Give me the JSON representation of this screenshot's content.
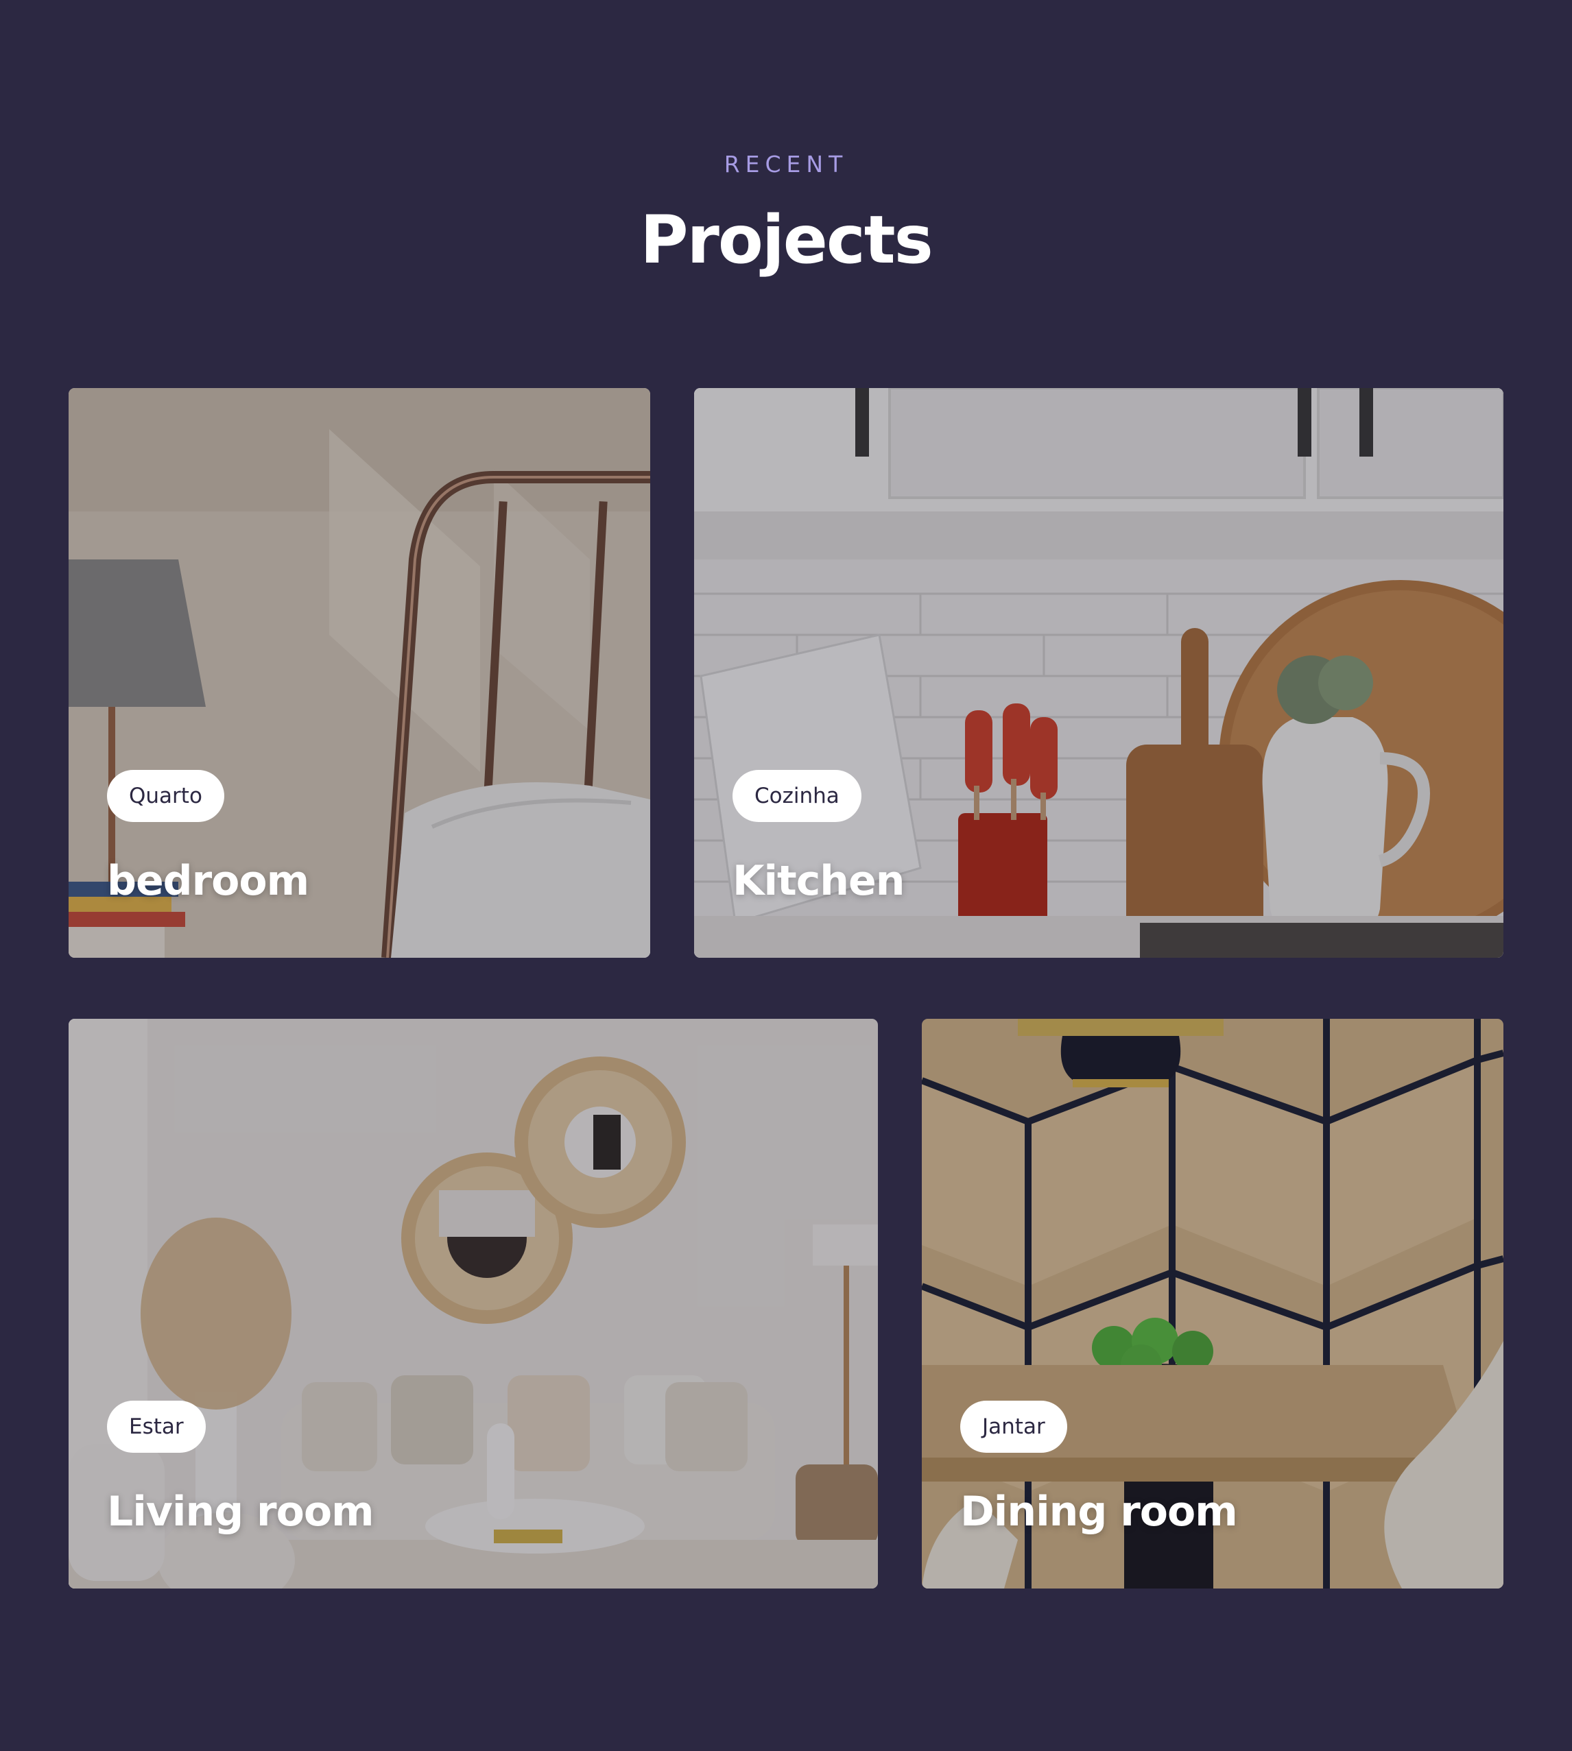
{
  "section": {
    "eyebrow": "RECENT",
    "title": "Projects"
  },
  "projects": [
    {
      "tag": "Quarto",
      "name": "bedroom",
      "image": "bedroom-photo"
    },
    {
      "tag": "Cozinha",
      "name": "Kitchen",
      "image": "kitchen-photo"
    },
    {
      "tag": "Estar",
      "name": "Living room",
      "image": "living-room-photo"
    },
    {
      "tag": "Jantar",
      "name": "Dining room",
      "image": "dining-room-photo"
    }
  ],
  "colors": {
    "background": "#2c2842",
    "eyebrow": "#a79ce4",
    "title": "#ffffff",
    "tag_background": "#ffffff",
    "tag_text": "#2c2842"
  }
}
